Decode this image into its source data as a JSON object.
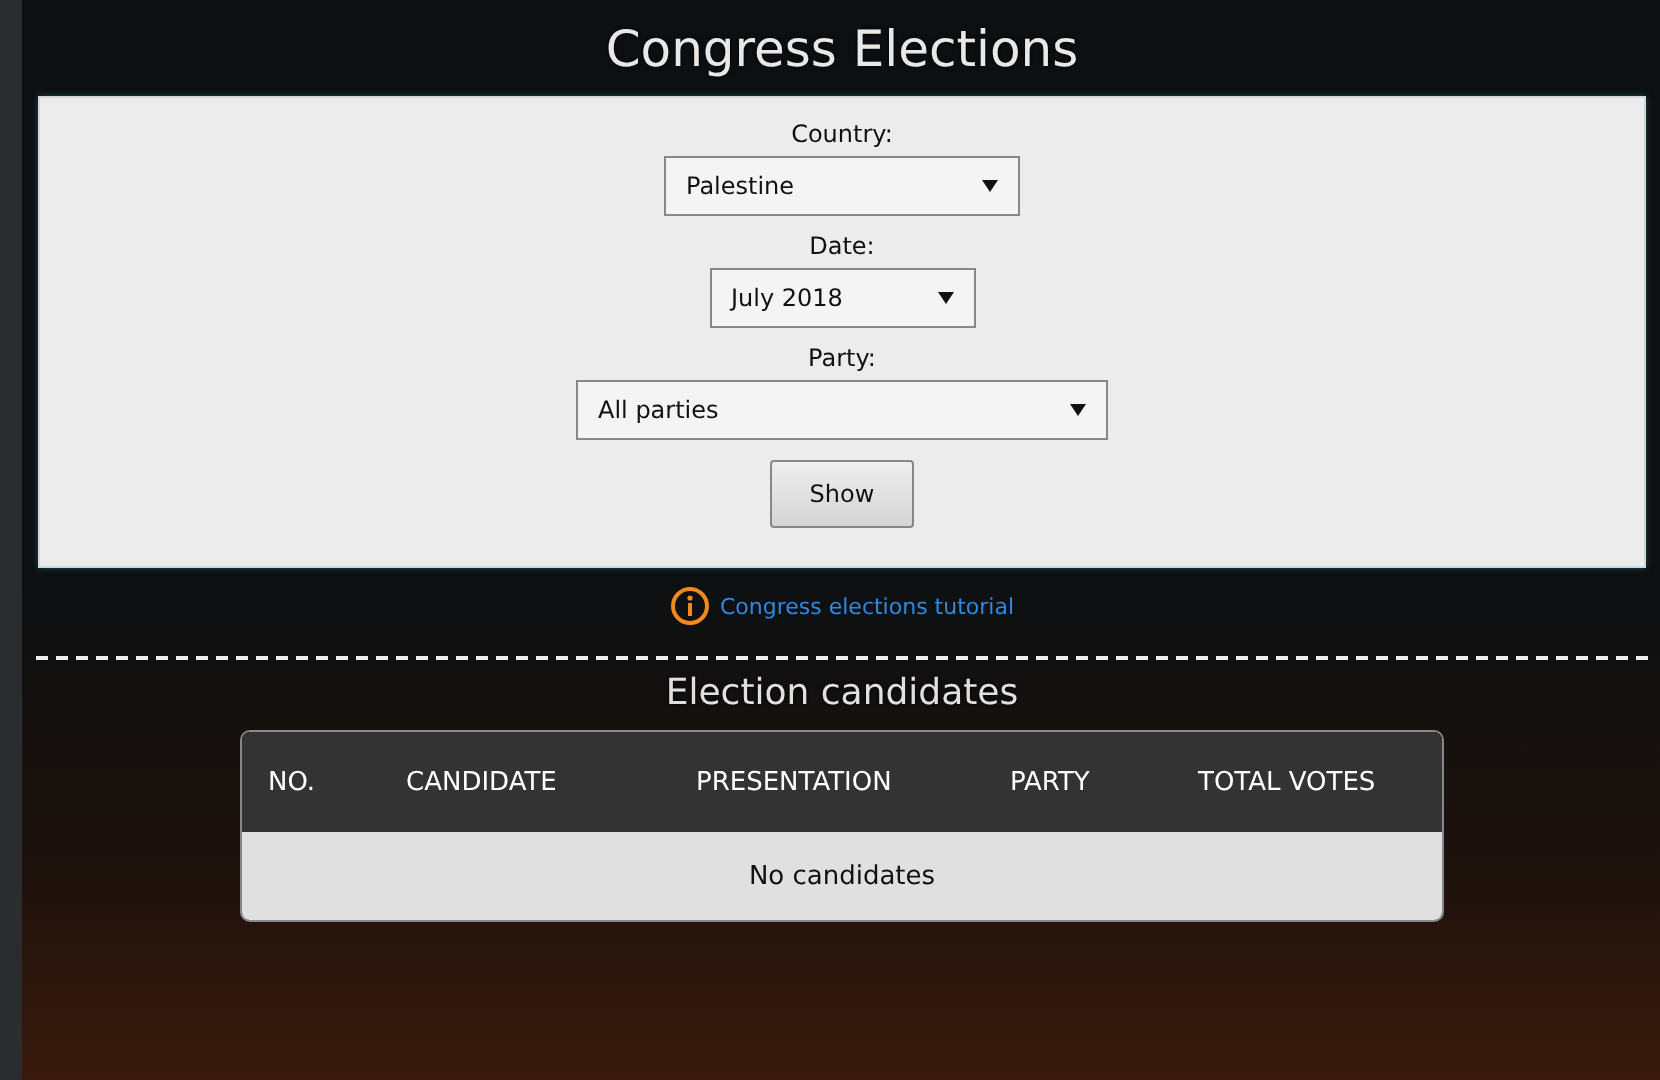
{
  "title": "Congress Elections",
  "form": {
    "fields": [
      {
        "label": "Country:",
        "value": "Palestine"
      },
      {
        "label": "Date:",
        "value": "July 2018"
      },
      {
        "label": "Party:",
        "value": "All parties"
      }
    ],
    "button": "Show"
  },
  "tutorial_link": "Congress elections tutorial",
  "section_title": "Election candidates",
  "table": {
    "columns": [
      "NO.",
      "CANDIDATE",
      "PRESENTATION",
      "PARTY",
      "TOTAL VOTES"
    ],
    "empty_message": "No candidates"
  }
}
